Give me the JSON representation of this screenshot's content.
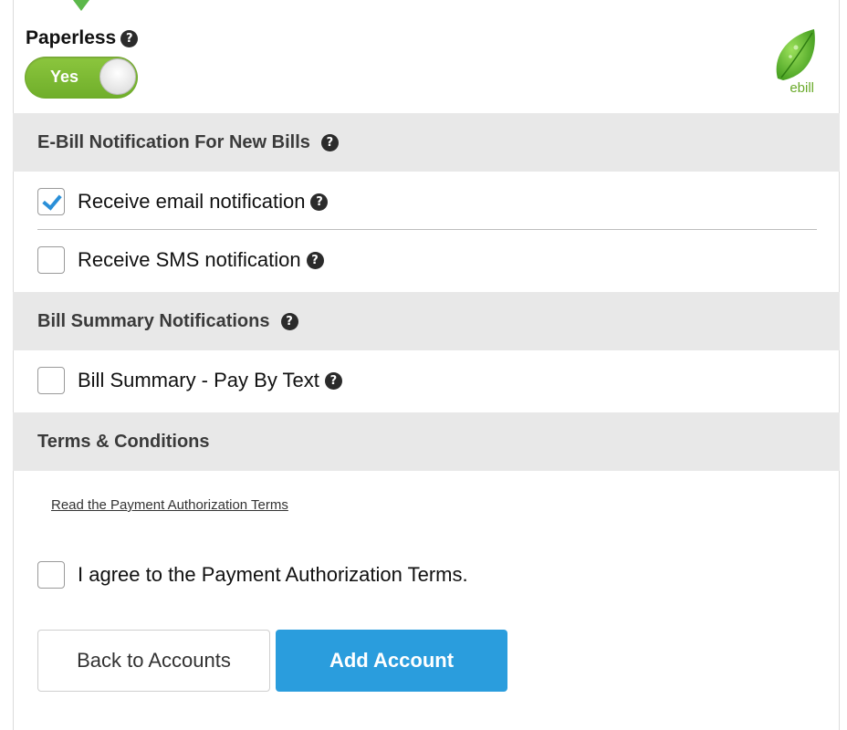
{
  "paperless": {
    "label": "Paperless",
    "toggle_value": "Yes",
    "logo_text": "ebill"
  },
  "sections": {
    "ebill_notification": {
      "title": "E-Bill Notification For New Bills",
      "email": {
        "label": "Receive email notification",
        "checked": true
      },
      "sms": {
        "label": "Receive SMS notification",
        "checked": false
      }
    },
    "bill_summary": {
      "title": "Bill Summary Notifications",
      "pay_by_text": {
        "label": "Bill Summary - Pay By Text",
        "checked": false
      }
    },
    "terms": {
      "title": "Terms & Conditions",
      "link": "Read the Payment Authorization Terms",
      "agree": {
        "label": "I agree to the Payment Authorization Terms.",
        "checked": false
      }
    }
  },
  "buttons": {
    "back": "Back to Accounts",
    "add": "Add Account"
  },
  "colors": {
    "toggle_green": "#7dba34",
    "header_gray": "#e8e8e8",
    "primary_blue": "#2a9ddd",
    "check_blue": "#2a8fd8"
  },
  "icons": {
    "help": "question-circle-icon",
    "logo": "leaf-icon"
  }
}
